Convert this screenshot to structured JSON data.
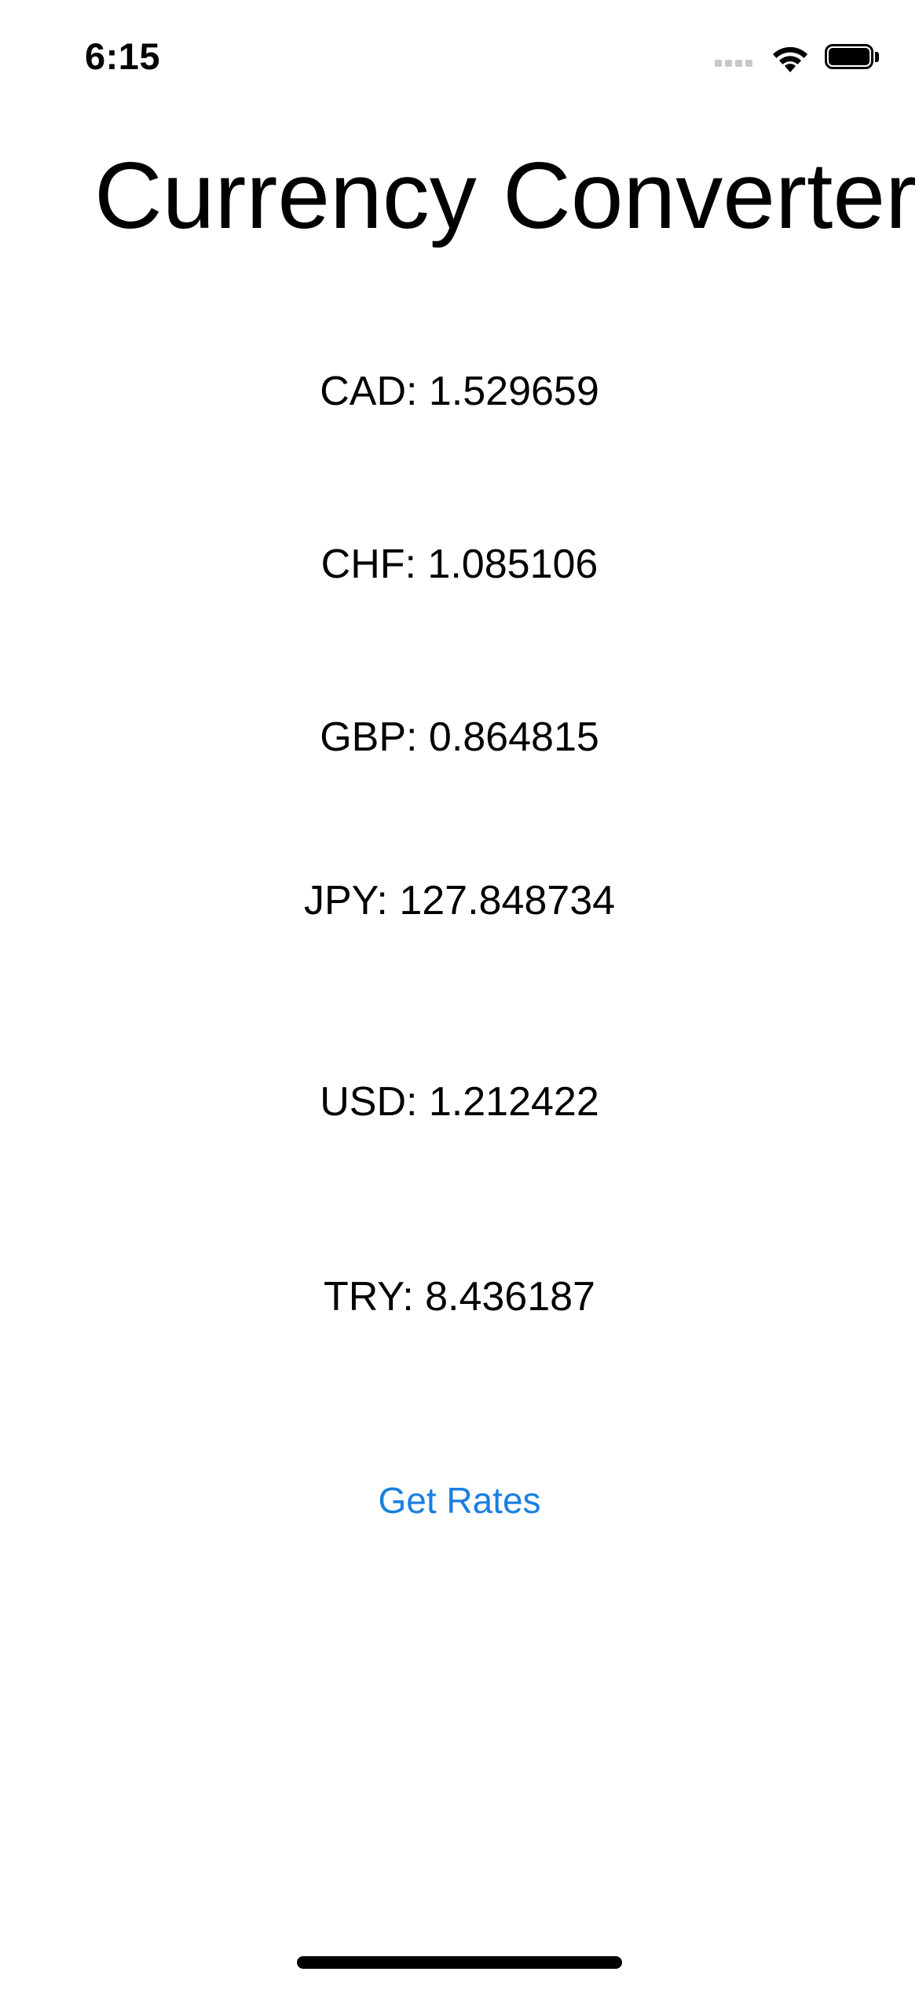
{
  "status_bar": {
    "time": "6:15"
  },
  "title": "Currency Converter",
  "rates": [
    "CAD: 1.529659",
    "CHF: 1.085106",
    "GBP: 0.864815",
    "JPY: 127.848734",
    "USD: 1.212422",
    "TRY: 8.436187"
  ],
  "get_rates_label": "Get Rates",
  "colors": {
    "accent": "#1a7fe0",
    "text": "#000000",
    "background": "#ffffff"
  }
}
